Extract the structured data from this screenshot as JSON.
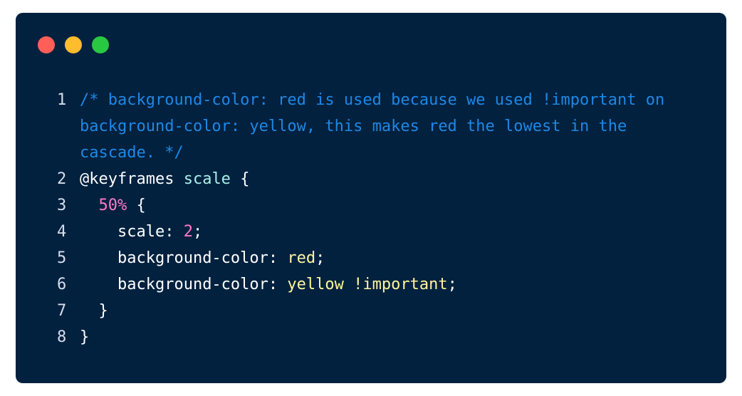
{
  "window": {
    "background": "#01213f",
    "traffic_lights": [
      {
        "name": "close",
        "color": "#ff5f57"
      },
      {
        "name": "minimize",
        "color": "#febc2e"
      },
      {
        "name": "maximize",
        "color": "#28c840"
      }
    ]
  },
  "code": {
    "lines": [
      {
        "number": "1",
        "comment": "/* background-color: red is used because we used !important on background-color: yellow, this makes red the lowest in the cascade. */"
      },
      {
        "number": "2",
        "at_rule": "@keyframes",
        "name": "scale",
        "open": "{"
      },
      {
        "number": "3",
        "indent": "  ",
        "selector": "50%",
        "open": "{"
      },
      {
        "number": "4",
        "indent": "    ",
        "property": "scale",
        "value": "2",
        "end": ";"
      },
      {
        "number": "5",
        "indent": "    ",
        "property": "background-color",
        "value": "red",
        "end": ";"
      },
      {
        "number": "6",
        "indent": "    ",
        "property": "background-color",
        "value": "yellow !important",
        "end": ";"
      },
      {
        "number": "7",
        "indent": "  ",
        "close": "}"
      },
      {
        "number": "8",
        "close": "}"
      }
    ]
  },
  "colors": {
    "comment": "#1e88e5",
    "selector_name": "#a8f0e8",
    "number": "#ff79c6",
    "string_value": "#fff59d",
    "text": "#ffffff"
  }
}
